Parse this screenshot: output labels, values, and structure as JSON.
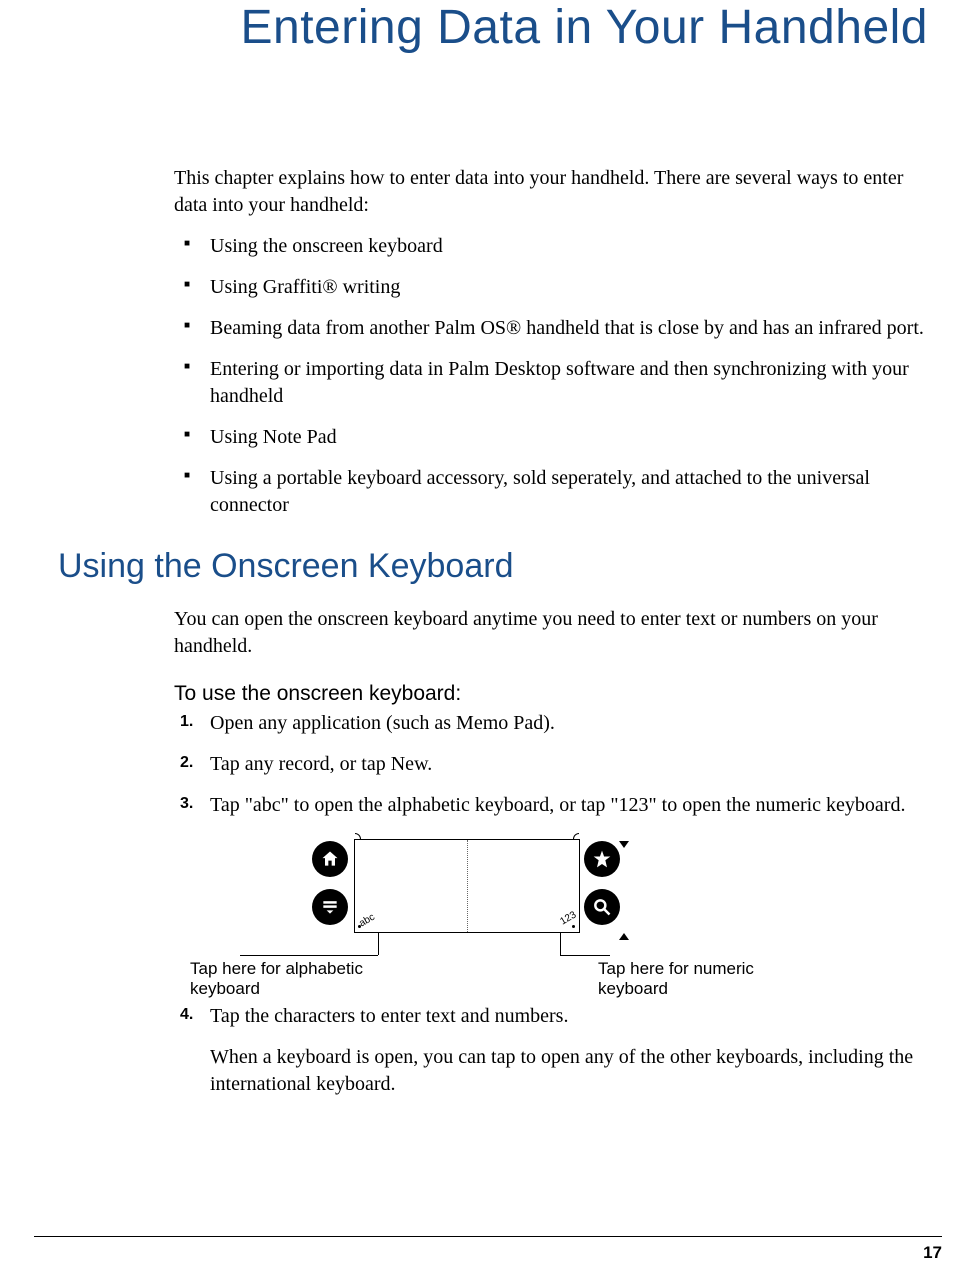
{
  "chapter_title": "Entering Data in Your Handheld",
  "intro": "This chapter explains how to enter data into your handheld. There are several ways to enter data into your handheld:",
  "bullets": [
    "Using the onscreen keyboard",
    "Using Graffiti® writing",
    "Beaming data from another Palm OS® handheld that is close by and has an infrared port.",
    "Entering or importing data in Palm Desktop software and then synchronizing with your handheld",
    "Using Note Pad",
    "Using a portable keyboard accessory, sold seperately, and attached to the universal connector"
  ],
  "section_heading": "Using the Onscreen Keyboard",
  "section_intro": "You can open the onscreen keyboard anytime you need to enter text or numbers on your handheld.",
  "procedure_heading": "To use the onscreen keyboard:",
  "steps": [
    "Open any application (such as Memo Pad).",
    "Tap any record, or tap New.",
    "Tap \"abc\" to open the alphabetic keyboard, or tap \"123\" to open the numeric keyboard.",
    "Tap the characters to enter text and numbers."
  ],
  "step4_note": "When a keyboard is open, you can tap to open any of the other keyboards, including the international keyboard.",
  "diagram": {
    "abc_label": "abc",
    "num_label": "123",
    "callout_left": "Tap here for alphabetic keyboard",
    "callout_right": "Tap here for numeric keyboard"
  },
  "page_number": "17"
}
